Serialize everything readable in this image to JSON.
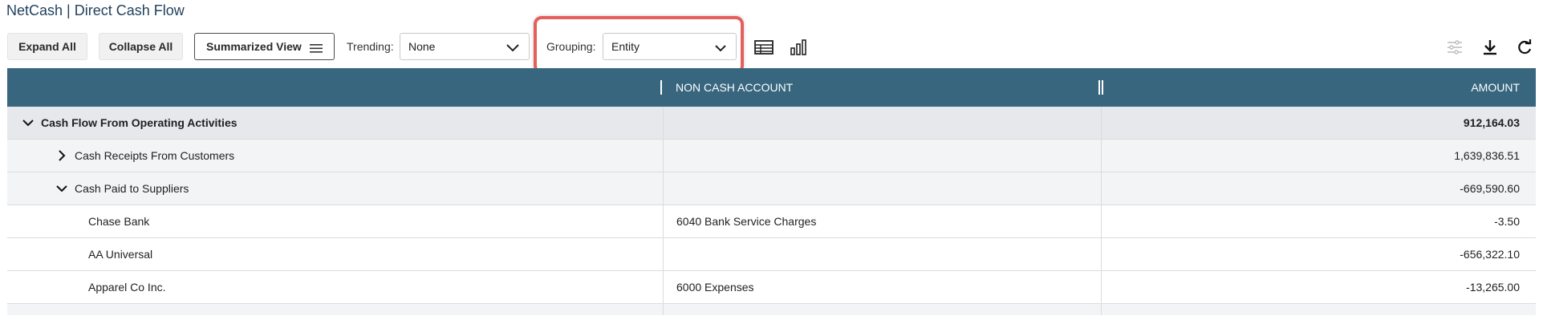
{
  "page": {
    "title": "NetCash | Direct Cash Flow"
  },
  "toolbar": {
    "expand_all": "Expand All",
    "collapse_all": "Collapse All",
    "summarized_view": "Summarized View",
    "trending_label": "Trending:",
    "trending_value": "None",
    "grouping_label": "Grouping:",
    "grouping_value": "Entity",
    "icons": [
      "table-view-icon",
      "chart-view-icon",
      "settings-sliders-icon",
      "download-icon",
      "refresh-icon"
    ]
  },
  "highlight_color": "#e4605c",
  "header_color": "#37667e",
  "grid": {
    "columns": [
      "",
      "NON CASH ACCOUNT",
      "AMOUNT"
    ],
    "rows": [
      {
        "level": 0,
        "expanded": true,
        "label": "Cash Flow From Operating Activities",
        "account": "",
        "amount": "912,164.03"
      },
      {
        "level": 1,
        "expanded": false,
        "label": "Cash Receipts From Customers",
        "account": "",
        "amount": "1,639,836.51"
      },
      {
        "level": 1,
        "expanded": true,
        "label": "Cash Paid to Suppliers",
        "account": "",
        "amount": "-669,590.60"
      },
      {
        "level": 2,
        "label": "Chase Bank",
        "account": "6040 Bank Service Charges",
        "amount": "-3.50"
      },
      {
        "level": 2,
        "label": "AA Universal",
        "account": "",
        "amount": "-656,322.10"
      },
      {
        "level": 2,
        "label": "Apparel Co Inc.",
        "account": "6000 Expenses",
        "amount": "-13,265.00"
      }
    ]
  }
}
